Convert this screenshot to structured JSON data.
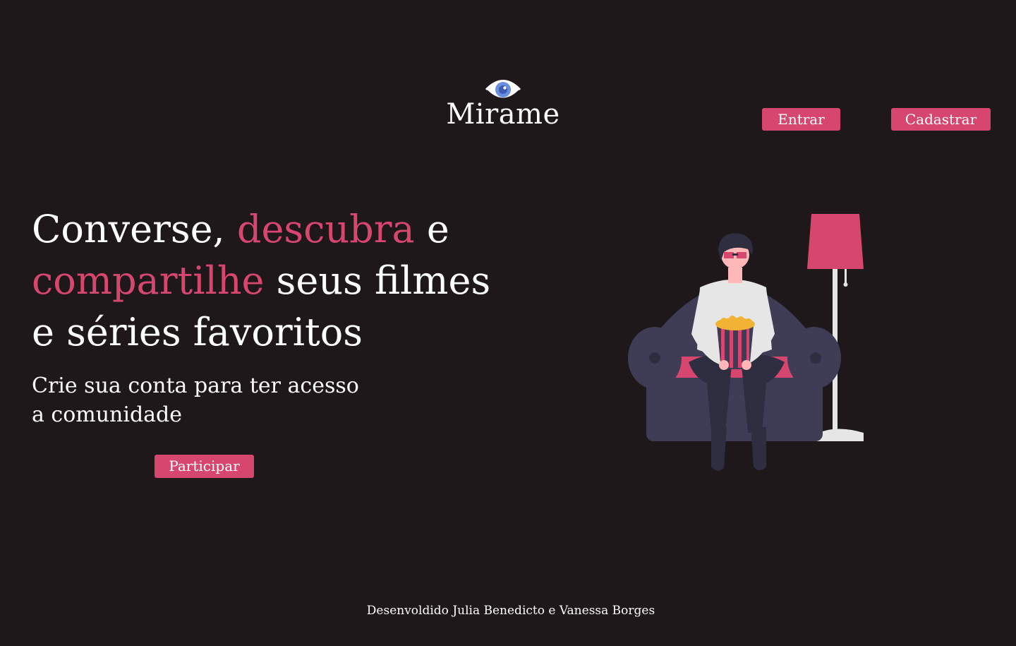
{
  "brand": {
    "name": "Mirame",
    "icon": "eye-icon",
    "accent_color": "#d6466f",
    "background_color": "#1f181b"
  },
  "header": {
    "login_label": "Entrar",
    "signup_label": "Cadastrar"
  },
  "hero": {
    "headline": {
      "part1": "Converse, ",
      "accent1": "descubra",
      "part2": " e",
      "accent2": "compartilhe",
      "part3": " seus filmes",
      "part4": "e séries favoritos"
    },
    "subheadline_line1": "Crie sua conta para ter acesso",
    "subheadline_line2": "a comunidade",
    "cta_label": "Participar",
    "illustration_icon": "person-on-couch-with-popcorn"
  },
  "footer": {
    "credits": "Desenvoldido Julia Benedicto e Vanessa Borges"
  }
}
